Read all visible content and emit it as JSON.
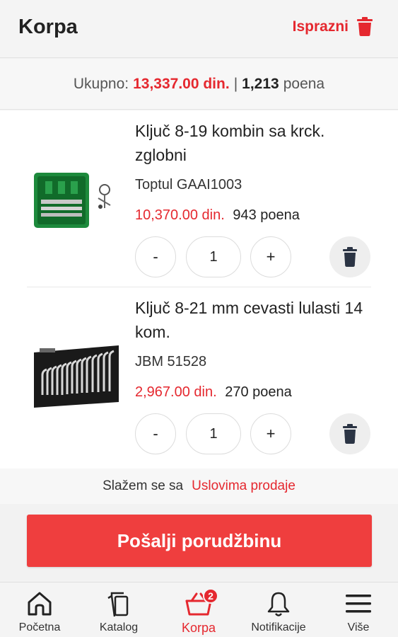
{
  "header": {
    "title": "Korpa",
    "clear_label": "Isprazni"
  },
  "summary": {
    "total_label": "Ukupno:",
    "total_value": "13,337.00 din.",
    "separator": "|",
    "points_value": "1,213",
    "points_label": "poena"
  },
  "cart": {
    "items": [
      {
        "name": "Ključ 8-19 kombin sa krck. zglobni",
        "code": "Toptul GAAI1003",
        "price": "10,370.00 din.",
        "points": "943 poena",
        "quantity": "1",
        "minus_label": "-",
        "plus_label": "+"
      },
      {
        "name": "Ključ 8-21 mm cevasti lulasti 14 kom.",
        "code": "JBM 51528",
        "price": "2,967.00 din.",
        "points": "270 poena",
        "quantity": "1",
        "minus_label": "-",
        "plus_label": "+"
      }
    ]
  },
  "terms": {
    "text": "Slažem se sa",
    "link": "Uslovima prodaje"
  },
  "submit_label": "Pošalji porudžbinu",
  "tabs": [
    {
      "label": "Početna",
      "icon": "home-icon"
    },
    {
      "label": "Katalog",
      "icon": "catalog-icon"
    },
    {
      "label": "Korpa",
      "icon": "basket-icon",
      "badge": "2",
      "active": true
    },
    {
      "label": "Notifikacije",
      "icon": "bell-icon"
    },
    {
      "label": "Više",
      "icon": "menu-icon"
    }
  ],
  "colors": {
    "accent": "#e5282f",
    "button": "#ef3e3e"
  }
}
